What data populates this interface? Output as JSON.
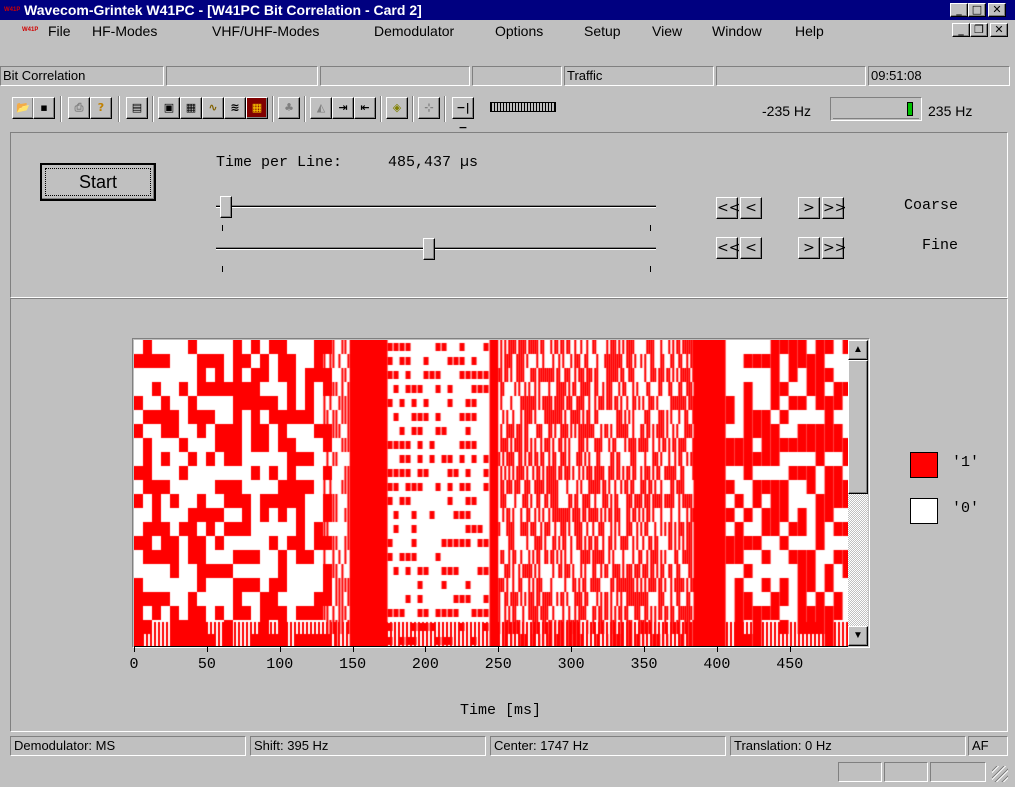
{
  "window": {
    "title": "Wavecom-Grintek W41PC - [W41PC Bit Correlation  - Card 2]",
    "icon_label": "W41PC"
  },
  "menu": {
    "items": [
      "File",
      "HF-Modes",
      "VHF/UHF-Modes",
      "Demodulator",
      "Options",
      "Setup",
      "View",
      "Window",
      "Help"
    ]
  },
  "status_top": {
    "mode": "Bit Correlation",
    "traffic": "Traffic",
    "time": "09:51:08"
  },
  "toolbar": {
    "freq_min": "-235 Hz",
    "freq_max": "235 Hz",
    "icons": [
      "open-icon",
      "save-icon",
      "print-icon",
      "help-icon",
      "table-icon",
      "display-icon",
      "keyboard-icon",
      "signal-icon",
      "waterfall-icon",
      "correlation-icon",
      "tune-icon",
      "spectrum-icon",
      "shift-left-icon",
      "shift-right-icon",
      "target-icon",
      "resize-icon",
      "marker-icon",
      "bar-icon"
    ]
  },
  "controls": {
    "start_label": "Start",
    "time_per_line_label": "Time per Line:",
    "time_per_line_value": "485,437 µs",
    "coarse_label": "Coarse",
    "fine_label": "Fine",
    "coarse_slider": 0.01,
    "fine_slider": 0.47,
    "nav_labels": [
      "<<",
      "<",
      ">",
      ">>"
    ]
  },
  "chart_data": {
    "type": "heatmap",
    "xlabel": "Time [ms]",
    "xlim": [
      0,
      490
    ],
    "xticks": [
      0,
      50,
      100,
      150,
      200,
      250,
      300,
      350,
      400,
      450
    ],
    "legend": [
      {
        "label": "'1'",
        "color": "#ff0000"
      },
      {
        "label": "'0'",
        "color": "#ffffff"
      }
    ],
    "colors": {
      "one": "#ff0000",
      "zero": "#ffffff"
    },
    "solid_one_bands_ms": [
      [
        148,
        174
      ],
      [
        244,
        250
      ],
      [
        384,
        406
      ]
    ]
  },
  "status_bottom": {
    "demodulator": "Demodulator: MS",
    "shift": "Shift: 395 Hz",
    "center": "Center: 1747 Hz",
    "translation": "Translation: 0 Hz",
    "af": "AF"
  }
}
